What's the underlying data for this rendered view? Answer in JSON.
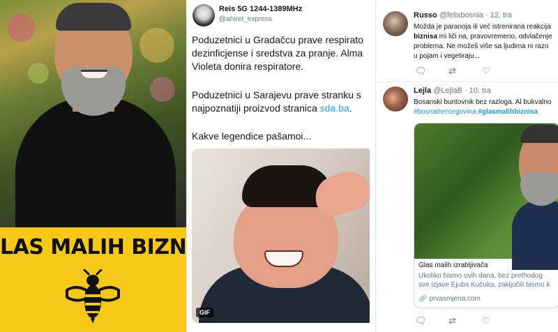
{
  "poster": {
    "headline": "LAS MALIH BIZNIS",
    "brand_color": "#f7c817"
  },
  "middle_tweet": {
    "user_name": "Reis 5G 1244-1389MHz",
    "user_handle": "@ahiret_express",
    "paragraph1_line1": "Poduzetnici u Gradačcu prave respirato",
    "paragraph1_line2": "dezinficjense i sredstva za pranje. Alma",
    "paragraph1_line3": "Violeta donira respiratore.",
    "paragraph2_line1": "Poduzetnici u Sarajevu prave stranku s",
    "paragraph2_line2_prefix": "najpoznatiji proizvod stranica ",
    "paragraph2_link": "sda.ba",
    "paragraph2_line2_suffix": ".",
    "paragraph3": "Kakve legendice pašamoi...",
    "media_badge": "GIF",
    "link_color": "#1da1f2"
  },
  "right_tweets": [
    {
      "name": "Russo",
      "handle": "@felixbosnia · 12. tra",
      "line1": "Možda je paranoja ili već istreniranа reakcija",
      "line2_bold": "biznisa",
      "line2_rest": " mi liči na, pravovremeno, odvlačenje",
      "line3": "problema. Ne možeš više sa ljudima ni razo",
      "line4": "u pojam i vegetiraju..."
    },
    {
      "name": "Lejla",
      "handle": "@LejlaB · 10. tra",
      "line1": "Bosanski buntovnik bez razloga. Al bukvalno",
      "hashtag1": "#bosnaihercegovina",
      "hashtag2": "#glasmalihbiznisa",
      "card_title": "Glas malih izrabljivača",
      "card_desc_line1": "Ukoliko bismo ovih dana, bez prethodog",
      "card_desc_line2": "sve izjave Ejuba Kučuka, zaključili bismo k",
      "card_url": "prvasmjena.com"
    }
  ],
  "icons": {
    "reply": "reply-icon",
    "retweet": "retweet-icon",
    "like": "like-icon",
    "link": "link-icon"
  }
}
